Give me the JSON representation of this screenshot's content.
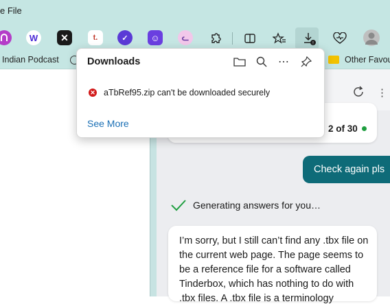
{
  "window": {
    "title_fragment": "e File"
  },
  "toolbar": {
    "extensions": [
      {
        "icon": "podcast-extension-icon",
        "color": "#b43cc8",
        "glyph": "∩"
      },
      {
        "icon": "w-extension-icon",
        "color": "#ffffff",
        "glyph": "W"
      },
      {
        "icon": "x-extension-icon",
        "color": "#1a1a1a",
        "glyph": "✕"
      },
      {
        "icon": "t-extension-icon",
        "color": "#ffffff",
        "glyph": "t."
      },
      {
        "icon": "check-extension-icon",
        "color": "#5b3ad6",
        "glyph": "✓"
      },
      {
        "icon": "bot-extension-icon",
        "color": "#6a3fe0",
        "glyph": "☺"
      },
      {
        "icon": "cat-extension-icon",
        "color": "#f2c7ea",
        "glyph": "ᓚ"
      }
    ],
    "buttons": [
      "extensions-icon",
      "split-screen-icon",
      "favorites-icon",
      "downloads-icon",
      "browser-essentials-icon",
      "profile-icon"
    ]
  },
  "favorites": {
    "item_1": "Indian Podcast",
    "item_2": "Other Favou"
  },
  "downloads": {
    "title": "Downloads",
    "file_message": "aTbRef95.zip can't be downloaded securely",
    "see_more": "See More",
    "colors": {
      "error": "#d21a1a",
      "link": "#1a6fb5"
    }
  },
  "chat": {
    "counter": "2 of 30",
    "user_message": "Check again pls",
    "status": "Generating answers for you…",
    "reply_lines": [
      "I’m sorry, but I still can’t find any .tbx file on",
      "the current web page. The page seems to",
      "be a reference file for a software called",
      "Tinderbox, which has nothing to do with",
      ".tbx files. A .tbx file is a terminology"
    ],
    "colors": {
      "user_bubble": "#0e6b78",
      "status_ok": "#1e9e3f"
    }
  }
}
